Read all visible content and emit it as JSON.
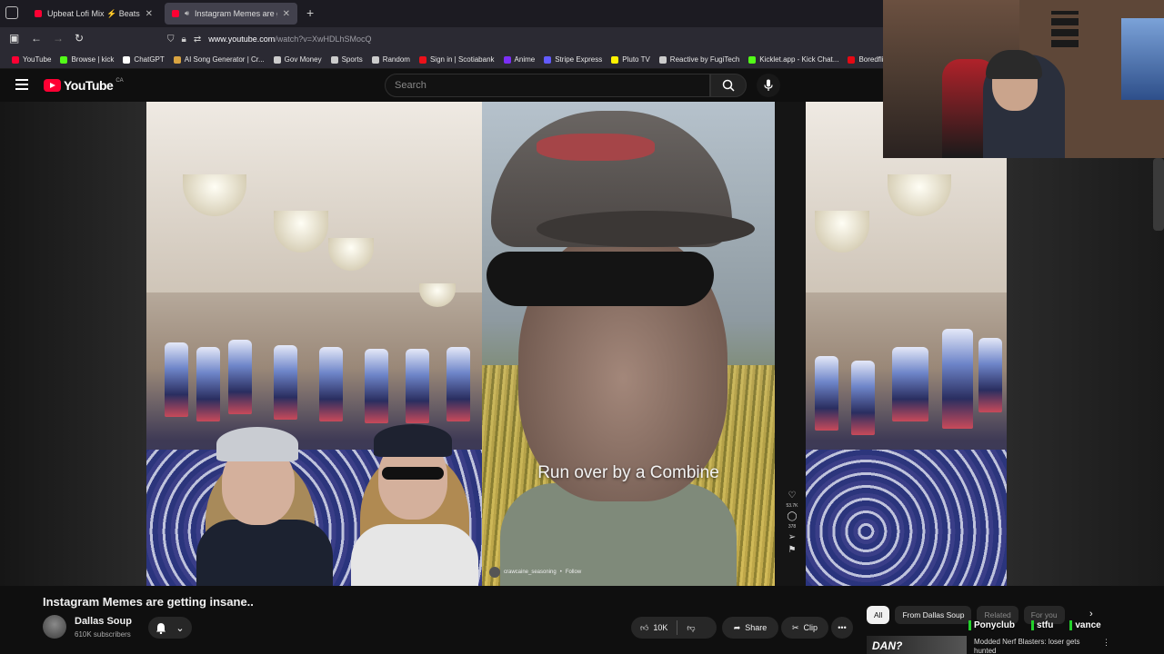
{
  "browser": {
    "tabs": [
      {
        "title": "Upbeat Lofi Mix ⚡ Beats to Bo",
        "active": false
      },
      {
        "title": "Instagram Memes are getti",
        "active": true
      }
    ],
    "url_host": "www.youtube.com",
    "url_path": "/watch?v=XwHDLhSMocQ",
    "bookmarks": [
      {
        "label": "YouTube",
        "color": "#ff0033"
      },
      {
        "label": "Browse | kick",
        "color": "#53fc18"
      },
      {
        "label": "ChatGPT",
        "color": "#ffffff"
      },
      {
        "label": "AI Song Generator | Cr...",
        "color": "#d9a441"
      },
      {
        "label": "Gov Money",
        "color": "#cccccc"
      },
      {
        "label": "Sports",
        "color": "#cccccc"
      },
      {
        "label": "Random",
        "color": "#cccccc"
      },
      {
        "label": "Sign in | Scotiabank",
        "color": "#ec111a"
      },
      {
        "label": "Anime",
        "color": "#7b2ff7"
      },
      {
        "label": "Stripe Express",
        "color": "#635bff"
      },
      {
        "label": "Pluto TV",
        "color": "#fff200"
      },
      {
        "label": "Reactive by FugiTech",
        "color": "#cccccc"
      },
      {
        "label": "Kicklet.app - Kick Chat...",
        "color": "#53fc18"
      },
      {
        "label": "Boredflix | Watch",
        "color": "#e50914"
      }
    ]
  },
  "youtube": {
    "logo_text": "YouTube",
    "country_code": "CA",
    "search_placeholder": "Search"
  },
  "video": {
    "caption": "Run over by a Combine",
    "reel_username": "crawcaine_seasoning",
    "reel_follow": "Follow",
    "reel_like_count": "53.7K",
    "reel_comment_count": "378"
  },
  "below": {
    "title": "Instagram Memes are getting insane..",
    "channel_name": "Dallas Soup",
    "subscribers": "610K subscribers",
    "like_count": "10K",
    "share_label": "Share",
    "clip_label": "Clip",
    "chips": [
      {
        "label": "All",
        "state": "active"
      },
      {
        "label": "From Dallas Soup",
        "state": "normal"
      },
      {
        "label": "Related",
        "state": "dim"
      },
      {
        "label": "For you",
        "state": "dim"
      }
    ],
    "alerts": [
      "Ponyclub",
      "stfu",
      "vance"
    ],
    "rec_thumb_text": "DAN?",
    "rec_title": "Modded Nerf Blasters: loser gets hunted"
  },
  "colors": {
    "accent_red": "#ff0033",
    "alert_green": "#22d12a"
  }
}
